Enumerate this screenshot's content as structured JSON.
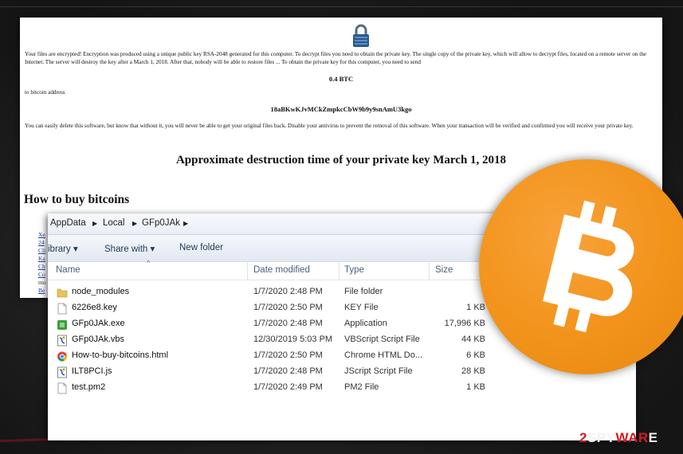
{
  "ransom_note": {
    "paragraph1": "Your files are encrypted! Encryption was produced using a unique public key RSA-2048 generated for this computer. To decrypt files you need to obtain the private key. The single copy of the private key, which will allow to decrypt files, located on a remote server on the Internet. The server will destroy the key after a March 1, 2018. After that, nobody will be able to restore files ... To obtain the private key for this computer, you need to send",
    "amount": "0.4 BTC",
    "to_address_label": "to bitcoin address",
    "bitcoin_address": "18aBKwKJvMCkZmpkcCbW9b9y9snAmU3kgo",
    "paragraph2": "You can easily delete this software, but know that without it, you will never be able to get your original files back. Disable your antivirus to prevent the removal of this software. When your transaction will be verified and confirmed you will receive your private key.",
    "destruction_heading": "Approximate destruction time of your private key March 1, 2018",
    "buy_heading": "How to buy bitcoins",
    "link_fragments": [
      "Xe",
      "24",
      "Cli",
      "Ka",
      "Ch",
      "Co",
      "mo",
      "Be"
    ]
  },
  "explorer": {
    "breadcrumb": [
      "AppData",
      "Local",
      "GFp0JAk"
    ],
    "breadcrumb_sep": "▶",
    "toolbar": {
      "library_label": "ibrary ▾",
      "share_label": "Share with ▾",
      "new_folder_label": "New folder"
    },
    "columns": {
      "name": "Name",
      "date": "Date modified",
      "type": "Type",
      "size": "Size"
    },
    "files": [
      {
        "name": "node_modules",
        "date": "1/7/2020 2:48 PM",
        "type": "File folder",
        "size": "",
        "icon": "folder-icon"
      },
      {
        "name": "6226e8.key",
        "date": "1/7/2020 2:50 PM",
        "type": "KEY File",
        "size": "1 KB",
        "icon": "file-icon"
      },
      {
        "name": "GFp0JAk.exe",
        "date": "1/7/2020 2:48 PM",
        "type": "Application",
        "size": "17,996 KB",
        "icon": "exe-icon"
      },
      {
        "name": "GFp0JAk.vbs",
        "date": "12/30/2019 5:03 PM",
        "type": "VBScript Script File",
        "size": "44 KB",
        "icon": "script-icon"
      },
      {
        "name": "How-to-buy-bitcoins.html",
        "date": "1/7/2020 2:50 PM",
        "type": "Chrome HTML Do...",
        "size": "6 KB",
        "icon": "chrome-icon"
      },
      {
        "name": "ILT8PCI.js",
        "date": "1/7/2020 2:48 PM",
        "type": "JScript Script File",
        "size": "28 KB",
        "icon": "script-icon"
      },
      {
        "name": "test.pm2",
        "date": "1/7/2020 2:49 PM",
        "type": "PM2 File",
        "size": "1 KB",
        "icon": "file-icon"
      }
    ]
  },
  "badges": {
    "bitcoin_logo": "bitcoin-icon",
    "bitcoin_color": "#f2931a"
  },
  "watermark": {
    "part1": "2",
    "part2": "SPY",
    "part3": "WAR",
    "part4": "E"
  }
}
